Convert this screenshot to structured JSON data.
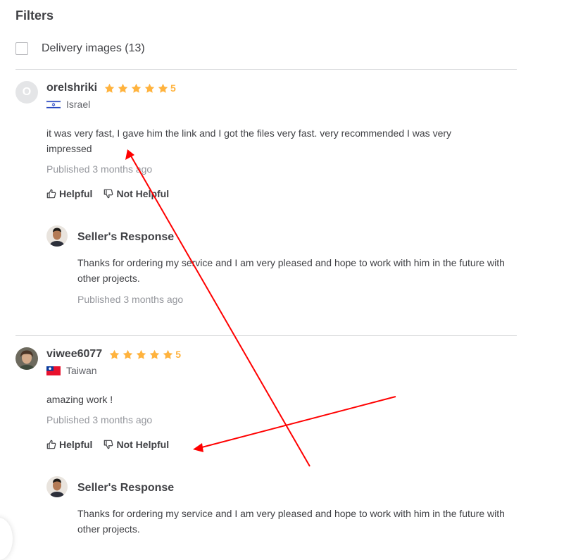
{
  "filters": {
    "title": "Filters",
    "delivery_images_label": "Delivery images (13)"
  },
  "reviews": [
    {
      "avatar_letter": "O",
      "username": "orelshriki",
      "rating": "5",
      "stars": 5,
      "country": "Israel",
      "text": "it was very fast, I gave him the link and I got the files very fast. very recommended I was very impressed",
      "published": "Published 3 months ago",
      "helpful": "Helpful",
      "not_helpful": "Not Helpful",
      "seller_response": {
        "title": "Seller's Response",
        "text": "Thanks for ordering my service and I am very pleased and hope to work with him in the future with other projects.",
        "published": "Published 3 months ago"
      }
    },
    {
      "username": "viwee6077",
      "rating": "5",
      "stars": 5,
      "country": "Taiwan",
      "text": "amazing work !",
      "published": "Published 3 months ago",
      "helpful": "Helpful",
      "not_helpful": "Not Helpful",
      "seller_response": {
        "title": "Seller's Response",
        "text": "Thanks for ordering my service and I am very pleased and hope to work with him in the future with other projects."
      }
    }
  ],
  "colors": {
    "star": "#ffb33e",
    "annotation_arrow": "#ff0000",
    "divider": "#dadbdd"
  }
}
